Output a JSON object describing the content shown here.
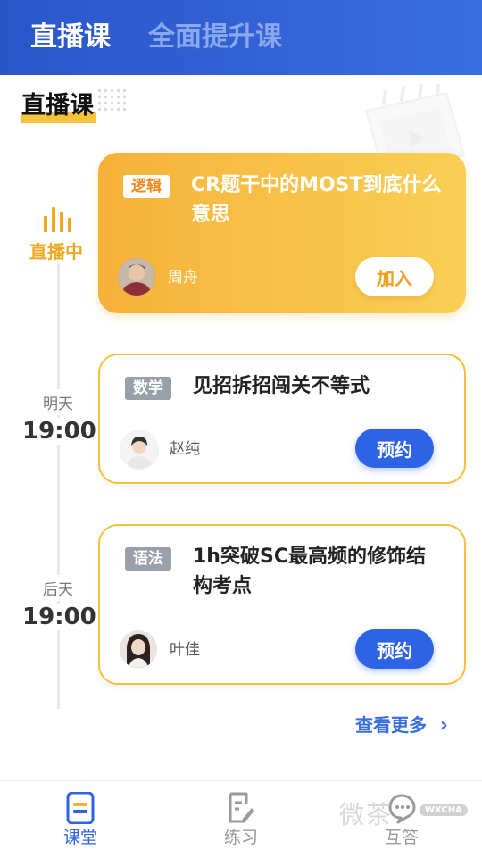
{
  "tabs": [
    {
      "label": "直播课",
      "active": true
    },
    {
      "label": "全面提升课",
      "active": false
    }
  ],
  "section_title": "直播课",
  "timeline": {
    "live_label": "直播中",
    "slots": [
      {
        "day": "明天",
        "time": "19:00"
      },
      {
        "day": "后天",
        "time": "19:00"
      }
    ]
  },
  "courses": [
    {
      "tag": "逻辑",
      "title": "CR题干中的MOST到底什么意思",
      "teacher": "周舟",
      "action": "加入",
      "status": "live"
    },
    {
      "tag": "数学",
      "title": "见招拆招闯关不等式",
      "teacher": "赵纯",
      "action": "预约",
      "status": "upcoming"
    },
    {
      "tag": "语法",
      "title": "1h突破SC最高频的修饰结构考点",
      "teacher": "叶佳",
      "action": "预约",
      "status": "upcoming"
    }
  ],
  "more_link": "查看更多",
  "more_arrow": "›",
  "bottom_nav": [
    {
      "label": "课堂",
      "icon": "classroom-icon",
      "active": true
    },
    {
      "label": "练习",
      "icon": "practice-icon",
      "active": false
    },
    {
      "label": "互答",
      "icon": "qa-chat-icon",
      "active": false
    }
  ],
  "watermark": {
    "text": "微茶",
    "badge": "WXCHA"
  },
  "colors": {
    "primary": "#2f63e6",
    "accent": "#f6b23a",
    "live_text": "#f0a81e"
  }
}
